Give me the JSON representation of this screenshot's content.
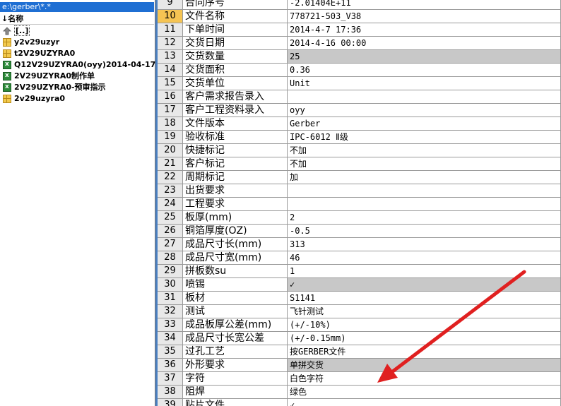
{
  "explorer": {
    "path": "e:\\gerber\\*.*",
    "column_header": "↓名称",
    "files": [
      {
        "name": "[..]",
        "type": "up",
        "icon": "up-arrow-icon"
      },
      {
        "name": "y2v29uzyr",
        "type": "folder",
        "icon": "folder-icon"
      },
      {
        "name": "t2V29UZYRA0",
        "type": "folder",
        "icon": "folder-icon"
      },
      {
        "name": "Q12V29UZYRA0(oyy)2014-04-17",
        "type": "xls",
        "icon": "excel-file-icon"
      },
      {
        "name": "2V29UZYRA0制作单",
        "type": "xls",
        "icon": "excel-file-icon"
      },
      {
        "name": "2V29UZYRA0-预审指示",
        "type": "xls",
        "icon": "excel-file-icon"
      },
      {
        "name": "2v29uzyra0",
        "type": "folder",
        "icon": "folder-icon"
      }
    ]
  },
  "sheet": {
    "selected_row": "10",
    "rows": [
      {
        "num": "9",
        "label": "合同序号",
        "value": "-2.01404E+11"
      },
      {
        "num": "10",
        "label": "文件名称",
        "value": "778721-503_V38"
      },
      {
        "num": "11",
        "label": "下单时间",
        "value": "2014-4-7 17:36"
      },
      {
        "num": "12",
        "label": "交货日期",
        "value": "2014-4-16 00:00"
      },
      {
        "num": "13",
        "label": "交货数量",
        "value": "25",
        "shaded": true
      },
      {
        "num": "14",
        "label": "交货面积",
        "value": "0.36"
      },
      {
        "num": "15",
        "label": "交货单位",
        "value": "Unit"
      },
      {
        "num": "16",
        "label": "客户需求报告录入",
        "value": ""
      },
      {
        "num": "17",
        "label": "客户工程资料录入",
        "value": "oyy"
      },
      {
        "num": "18",
        "label": "文件版本",
        "value": "Gerber"
      },
      {
        "num": "19",
        "label": "验收标准",
        "value": "IPC-6012 Ⅱ级"
      },
      {
        "num": "20",
        "label": "快捷标记",
        "value": "不加"
      },
      {
        "num": "21",
        "label": "客户标记",
        "value": "不加"
      },
      {
        "num": "22",
        "label": "周期标记",
        "value": "加"
      },
      {
        "num": "23",
        "label": "出货要求",
        "value": ""
      },
      {
        "num": "24",
        "label": "工程要求",
        "value": ""
      },
      {
        "num": "25",
        "label": "板厚(mm)",
        "value": "2"
      },
      {
        "num": "26",
        "label": "铜箔厚度(OZ)",
        "value": "-0.5"
      },
      {
        "num": "27",
        "label": "成品尺寸长(mm)",
        "value": "313"
      },
      {
        "num": "28",
        "label": "成品尺寸宽(mm)",
        "value": "46"
      },
      {
        "num": "29",
        "label": "拼板数su",
        "value": "1"
      },
      {
        "num": "30",
        "label": "喷锡",
        "value": "✓",
        "shaded": true
      },
      {
        "num": "31",
        "label": "板材",
        "value": "S1141"
      },
      {
        "num": "32",
        "label": "测试",
        "value": "飞针测试"
      },
      {
        "num": "33",
        "label": "成品板厚公差(mm)",
        "value": "(+/-10%)"
      },
      {
        "num": "34",
        "label": "成品尺寸长宽公差",
        "value": "(+/-0.15mm)"
      },
      {
        "num": "35",
        "label": "过孔工艺",
        "value": "按GERBER文件"
      },
      {
        "num": "36",
        "label": "外形要求",
        "value": "单拼交货",
        "shaded": true
      },
      {
        "num": "37",
        "label": "字符",
        "value": "白色字符"
      },
      {
        "num": "38",
        "label": "阻焊",
        "value": "绿色"
      },
      {
        "num": "39",
        "label": "贴片文件",
        "value": "✓"
      }
    ]
  },
  "colors": {
    "path_bar": "#1f6fd3",
    "row_header": "#e8e8e8",
    "selected_row_header": "#f5c453",
    "shaded_cell": "#c8c8c8",
    "annotation_arrow": "#e02020"
  }
}
